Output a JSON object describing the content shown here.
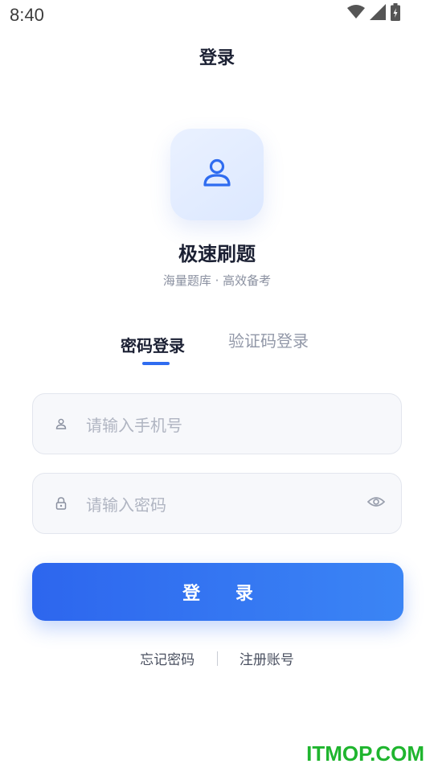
{
  "status_bar": {
    "time": "8:40",
    "icons": [
      "wifi-icon",
      "signal-icon",
      "battery-icon"
    ]
  },
  "header": {
    "title": "登录"
  },
  "brand": {
    "logo_icon": "user-icon",
    "name": "极速刷题",
    "slogan": "海量题库 · 高效备考"
  },
  "tabs": [
    {
      "label": "密码登录",
      "active": true
    },
    {
      "label": "验证码登录",
      "active": false
    }
  ],
  "form": {
    "phone": {
      "icon": "user-icon",
      "placeholder": "请输入手机号",
      "value": ""
    },
    "password": {
      "icon": "lock-icon",
      "placeholder": "请输入密码",
      "value": "",
      "toggle_icon": "eye-icon"
    },
    "submit_label": "登 录"
  },
  "links": {
    "forgot": "忘记密码",
    "register": "注册账号"
  },
  "watermark": "ITMOP.COM",
  "colors": {
    "accent": "#2f6cf0",
    "watermark": "#1fb52e"
  }
}
